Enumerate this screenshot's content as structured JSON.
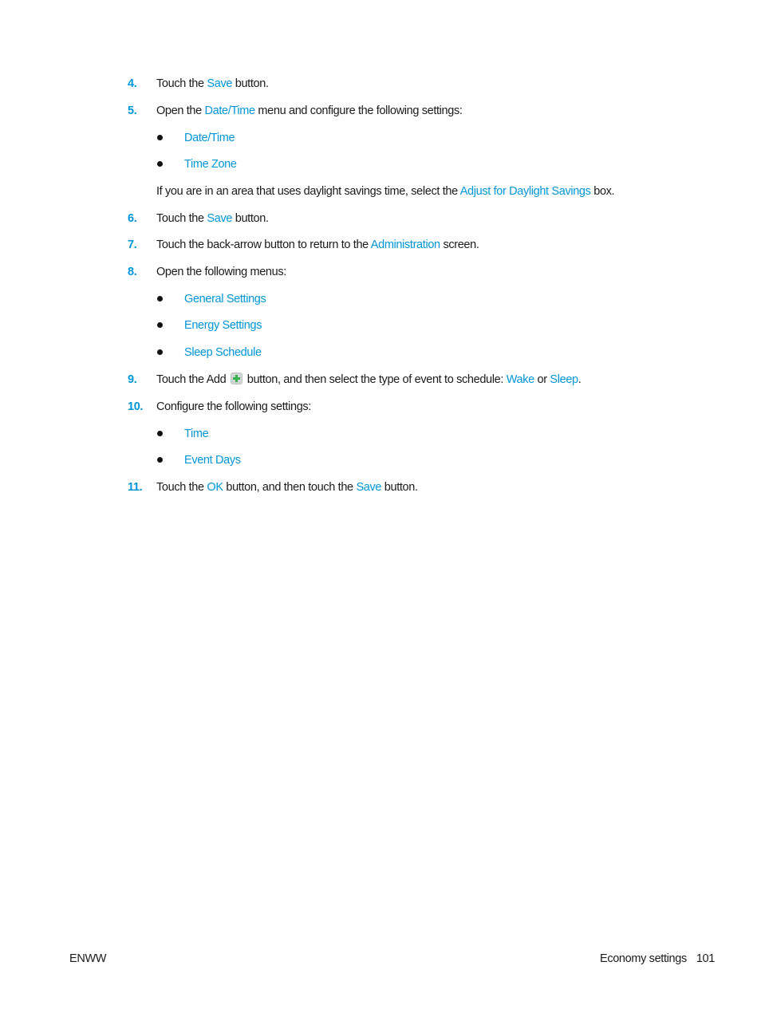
{
  "steps": [
    {
      "number": "4.",
      "pre": "Touch the ",
      "link": "Save",
      "post": " button."
    },
    {
      "number": "5.",
      "pre": "Open the ",
      "link": "Date/Time",
      "post": " menu and configure the following settings:",
      "bullets": [
        "Date/Time",
        "Time Zone"
      ],
      "note": {
        "pre": "If you are in an area that uses daylight savings time, select the ",
        "link": "Adjust for Daylight Savings",
        "post": " box."
      }
    },
    {
      "number": "6.",
      "pre": "Touch the ",
      "link": "Save",
      "post": " button."
    },
    {
      "number": "7.",
      "pre": "Touch the back-arrow button to return to the ",
      "link": "Administration",
      "post": " screen."
    },
    {
      "number": "8.",
      "text": "Open the following menus:",
      "bullets": [
        "General Settings",
        "Energy Settings",
        "Sleep Schedule"
      ]
    },
    {
      "number": "9.",
      "pre": "Touch the Add ",
      "icon": "add-icon",
      "mid": " button, and then select the type of event to schedule: ",
      "link1": "Wake",
      "or": " or ",
      "link2": "Sleep",
      "post": "."
    },
    {
      "number": "10.",
      "text": "Configure the following settings:",
      "bullets": [
        "Time",
        "Event Days"
      ]
    },
    {
      "number": "11.",
      "pre": "Touch the ",
      "link1": "OK",
      "mid": " button, and then touch the ",
      "link2": "Save",
      "post": " button."
    }
  ],
  "footer": {
    "left": "ENWW",
    "section": "Economy settings",
    "page_number": "101"
  },
  "colors": {
    "link": "#0096d6",
    "text": "#1a1a1a"
  }
}
